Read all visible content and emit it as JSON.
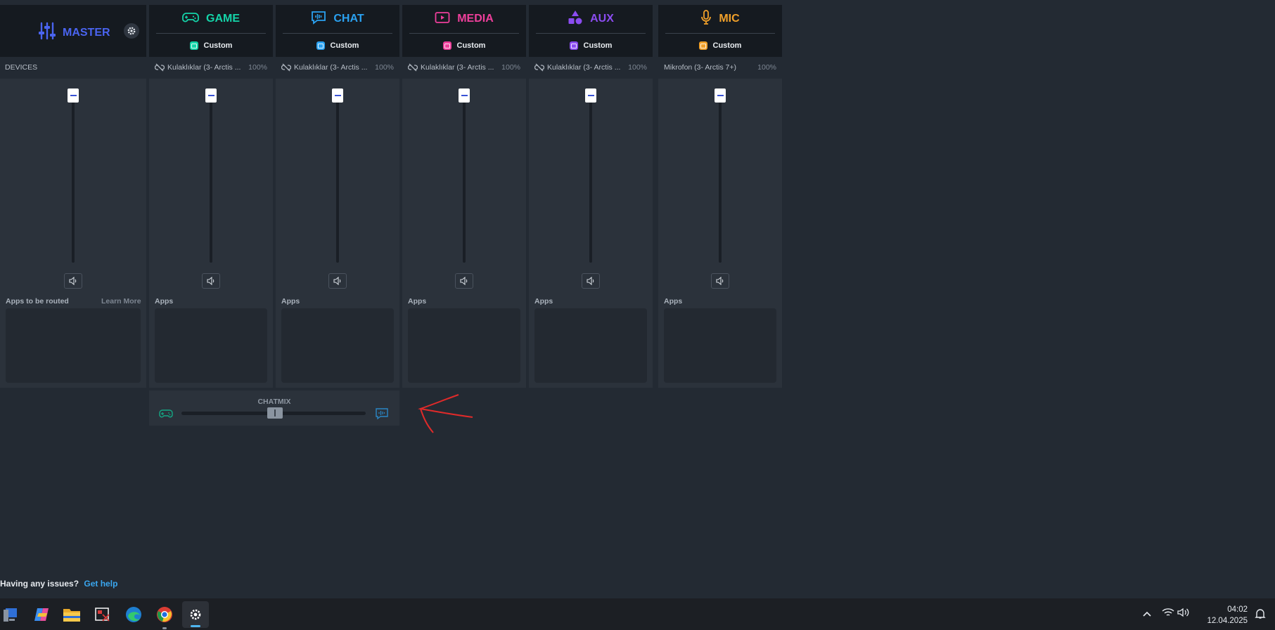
{
  "master": {
    "title": "MASTER",
    "devices_label": "DEVICES",
    "apps_label": "Apps to be routed",
    "learn_more": "Learn More"
  },
  "channels": [
    {
      "name": "GAME",
      "color": "#14d3a8",
      "preset": "Custom",
      "device": "Kulaklıklar (3- Arctis ...",
      "pct": "100%",
      "apps_label": "Apps"
    },
    {
      "name": "CHAT",
      "color": "#2aa1f0",
      "preset": "Custom",
      "device": "Kulaklıklar (3- Arctis ...",
      "pct": "100%",
      "apps_label": "Apps"
    },
    {
      "name": "MEDIA",
      "color": "#ee3f9b",
      "preset": "Custom",
      "device": "Kulaklıklar (3- Arctis ...",
      "pct": "100%",
      "apps_label": "Apps"
    },
    {
      "name": "AUX",
      "color": "#8b4cf0",
      "preset": "Custom",
      "device": "Kulaklıklar (3- Arctis ...",
      "pct": "100%",
      "apps_label": "Apps"
    },
    {
      "name": "MIC",
      "color": "#f0a02a",
      "preset": "Custom",
      "device": "Mikrofon (3- Arctis 7+)",
      "pct": "100%",
      "apps_label": "Apps"
    }
  ],
  "chatmix": {
    "label": "CHATMIX",
    "position": 0.5
  },
  "footer": {
    "issues": "Having any issues?",
    "help": "Get help"
  },
  "taskbar": {
    "time": "04:02",
    "date": "12.04.2025"
  },
  "colors": {
    "master": "#4a64f0",
    "bg": "#232a33"
  }
}
